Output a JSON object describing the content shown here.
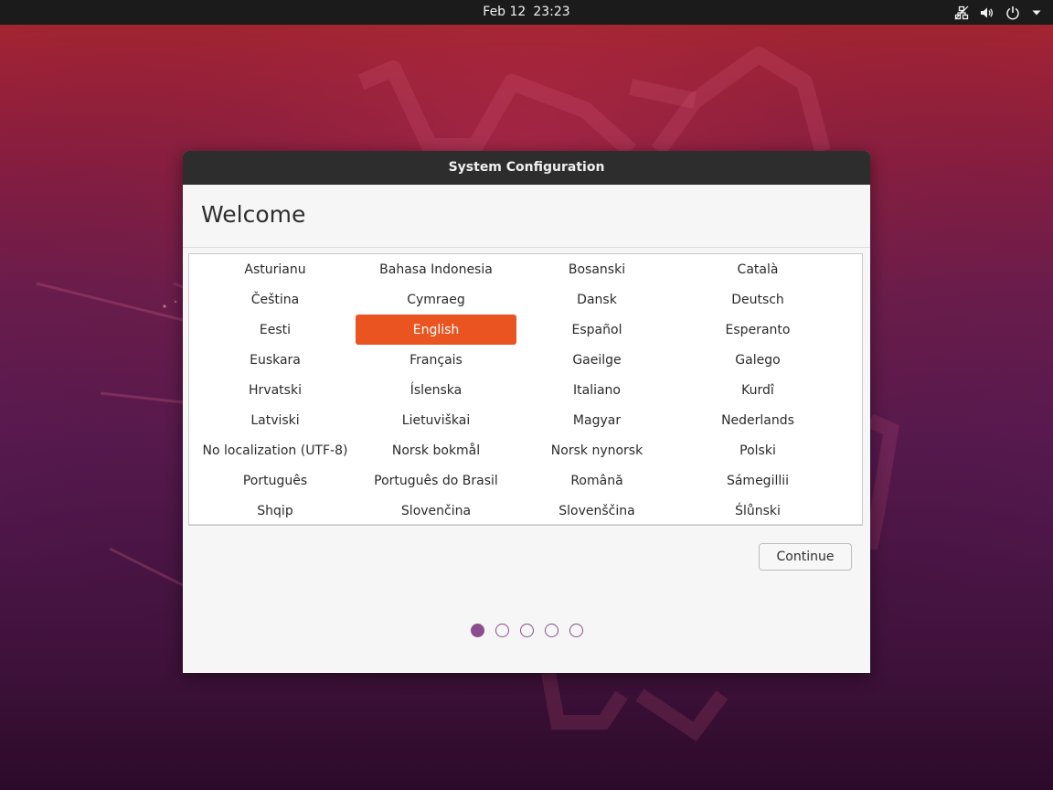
{
  "topbar": {
    "date": "Feb 12",
    "time": "23:23",
    "icons": [
      "network-icon",
      "volume-icon",
      "power-icon",
      "menu-arrow-icon"
    ]
  },
  "dialog": {
    "title": "System Configuration",
    "heading": "Welcome",
    "languages": [
      {
        "label": "Asturianu",
        "selected": false
      },
      {
        "label": "Bahasa Indonesia",
        "selected": false
      },
      {
        "label": "Bosanski",
        "selected": false
      },
      {
        "label": "Català",
        "selected": false
      },
      {
        "label": "Čeština",
        "selected": false
      },
      {
        "label": "Cymraeg",
        "selected": false
      },
      {
        "label": "Dansk",
        "selected": false
      },
      {
        "label": "Deutsch",
        "selected": false
      },
      {
        "label": "Eesti",
        "selected": false
      },
      {
        "label": "English",
        "selected": true
      },
      {
        "label": "Español",
        "selected": false
      },
      {
        "label": "Esperanto",
        "selected": false
      },
      {
        "label": "Euskara",
        "selected": false
      },
      {
        "label": "Français",
        "selected": false
      },
      {
        "label": "Gaeilge",
        "selected": false
      },
      {
        "label": "Galego",
        "selected": false
      },
      {
        "label": "Hrvatski",
        "selected": false
      },
      {
        "label": "Íslenska",
        "selected": false
      },
      {
        "label": "Italiano",
        "selected": false
      },
      {
        "label": "Kurdî",
        "selected": false
      },
      {
        "label": "Latviski",
        "selected": false
      },
      {
        "label": "Lietuviškai",
        "selected": false
      },
      {
        "label": "Magyar",
        "selected": false
      },
      {
        "label": "Nederlands",
        "selected": false
      },
      {
        "label": "No localization (UTF-8)",
        "selected": false
      },
      {
        "label": "Norsk bokmål",
        "selected": false
      },
      {
        "label": "Norsk nynorsk",
        "selected": false
      },
      {
        "label": "Polski",
        "selected": false
      },
      {
        "label": "Português",
        "selected": false
      },
      {
        "label": "Português do Brasil",
        "selected": false
      },
      {
        "label": "Română",
        "selected": false
      },
      {
        "label": "Sámegillii",
        "selected": false
      },
      {
        "label": "Shqip",
        "selected": false
      },
      {
        "label": "Slovenčina",
        "selected": false
      },
      {
        "label": "Slovenščina",
        "selected": false
      },
      {
        "label": "Ślůnski",
        "selected": false
      }
    ],
    "continue_label": "Continue",
    "pager": {
      "pages": 5,
      "current": 1
    }
  },
  "colors": {
    "accent": "#e95420",
    "pager": "#8a4e8e",
    "titlebar": "#2d2d2d",
    "topbar": "#1b1b1b"
  }
}
